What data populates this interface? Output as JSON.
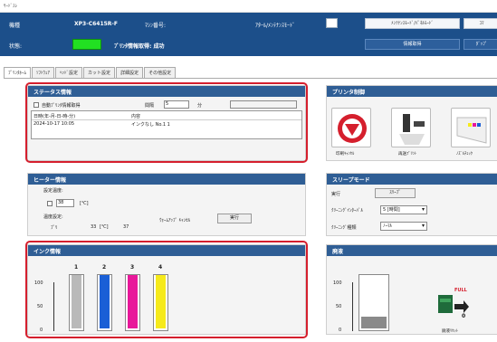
{
  "window": {
    "title": "ｻｰﾄﾞｽﾚ"
  },
  "topbar": {
    "model_label": "機種",
    "model_value": "XP3-C6415R-F",
    "model_no_label": "ﾏｼﾝ番号:",
    "mode_label": "ｱﾀｰﾙ/ﾒﾝﾃﾅﾝｽﾓｰﾄﾞ",
    "status_label": "状態:",
    "status_message": "ﾌﾟﾘﾝﾀ情報取得: 成功",
    "status_color": "#22e022",
    "btn_maintenance": "ﾒﾝﾃﾅﾝｽﾓｰﾄﾞ/ﾊﾟﾈﾙﾓｰﾄﾞ",
    "btn_fetch": "情報取得",
    "btn_right_top": "ｺﾏ",
    "btn_right_bottom": "ﾀﾞｯﾌﾟ"
  },
  "tabs": [
    "ﾌﾟﾘﾝﾀﾎｰﾑ",
    "ｿﾌﾄｳｪｱ",
    "ﾍｯﾄﾞ設定",
    "カット設定",
    "詳細設定",
    "その他設定"
  ],
  "status_panel": {
    "title": "ステータス情報",
    "auto_update_label": "自動ﾌﾟﾘﾝﾀ情報取得",
    "interval_label": "間隔",
    "interval_value": "5",
    "interval_unit": "分",
    "col_date": "日時(年-月-日-時-分)",
    "col_content": "内容",
    "log_date": "2024-10-17 10:05",
    "log_content": "インクなし No.1 1"
  },
  "heater_panel": {
    "title": "ヒーター情報",
    "setting_temp_label": "設定温度:",
    "setting_temp_value": "38",
    "temp_unit": "[℃]",
    "temp_setting_label": "温度設定:",
    "pre_label": "ﾌﾟﾘ",
    "pre_temp": "33",
    "unit": "[℃]",
    "platen_temp": "37",
    "print_label": "ﾌﾟﾘﾝﾄ",
    "warmup_label": "ｳｫｰﾑｱｯﾌﾟ ｷｬﾝｾﾙ",
    "warmup_btn": "実行"
  },
  "ink_panel": {
    "title": "インク情報",
    "axis_100": "100",
    "axis_50": "50",
    "axis_0": "0",
    "cartridges": [
      {
        "num": "1",
        "color": "#b9b9b9",
        "level": 1.0
      },
      {
        "num": "2",
        "color": "#1a5fd6",
        "level": 1.0
      },
      {
        "num": "3",
        "color": "#e8189a",
        "level": 1.0
      },
      {
        "num": "4",
        "color": "#f6ea1a",
        "level": 1.0
      }
    ]
  },
  "printer_panel": {
    "title": "プリンタ制御",
    "btn_stop": "印刷ｷｬﾝｾﾙ",
    "btn_clean": "再送ﾌﾟﾘﾝﾄ",
    "btn_nozzle": "ﾉｽﾞﾙﾁｪｯｸ"
  },
  "sleep_panel": {
    "title": "スリープモード",
    "exec_label": "実行",
    "exec_btn": "ｽﾘｰﾌﾟ",
    "cleaning_label": "ｸﾘｰﾆﾝｸﾞｲﾝﾀｰﾊﾞﾙ",
    "cleaning_value": "5 [時間]",
    "type_label": "ｸﾘｰﾆﾝｸﾞ種類",
    "type_value": "ﾉｰﾏﾙ"
  },
  "waste_panel": {
    "title": "廃液",
    "axis_100": "100",
    "axis_50": "50",
    "axis_0": "0",
    "level": 0.22,
    "count": "0",
    "reset_btn": "廃液ﾘｾｯﾄ",
    "alert_label": "FULL"
  }
}
